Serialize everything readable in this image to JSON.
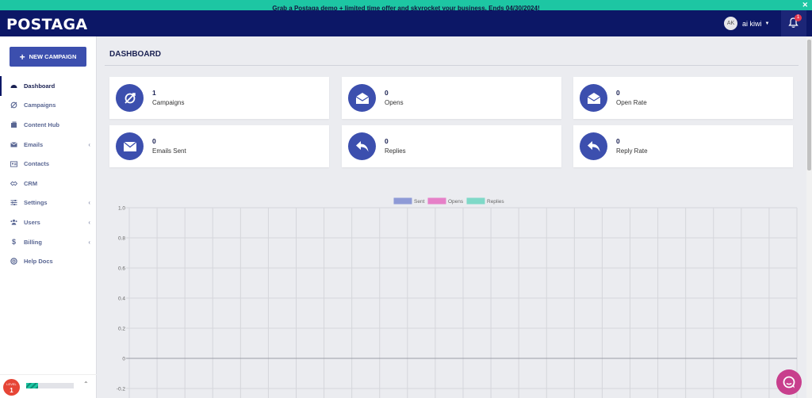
{
  "promo": {
    "text": "Grab a Postaga demo + limited time offer and skyrocket your business. Ends 04/30/2024!",
    "close": "✕"
  },
  "header": {
    "logo": "POSTAGA",
    "user": {
      "initials": "AK",
      "name": "ai kiwi"
    },
    "notifications": {
      "count": "1"
    }
  },
  "sidebar": {
    "new_campaign": "NEW CAMPAIGN",
    "items": [
      {
        "label": "Dashboard",
        "icon": "dashboard-icon",
        "active": true,
        "has_submenu": false
      },
      {
        "label": "Campaigns",
        "icon": "campaigns-icon",
        "active": false,
        "has_submenu": false
      },
      {
        "label": "Content Hub",
        "icon": "content-hub-icon",
        "active": false,
        "has_submenu": false
      },
      {
        "label": "Emails",
        "icon": "envelope-icon",
        "active": false,
        "has_submenu": true
      },
      {
        "label": "Contacts",
        "icon": "contacts-icon",
        "active": false,
        "has_submenu": false
      },
      {
        "label": "CRM",
        "icon": "crm-icon",
        "active": false,
        "has_submenu": false
      },
      {
        "label": "Settings",
        "icon": "settings-icon",
        "active": false,
        "has_submenu": true
      },
      {
        "label": "Users",
        "icon": "users-icon",
        "active": false,
        "has_submenu": true
      },
      {
        "label": "Billing",
        "icon": "dollar-icon",
        "active": false,
        "has_submenu": true
      },
      {
        "label": "Help Docs",
        "icon": "help-icon",
        "active": false,
        "has_submenu": false
      }
    ],
    "level": {
      "label": "LEVEL",
      "value": "1",
      "progress": 0.25
    }
  },
  "main": {
    "title": "DASHBOARD",
    "stats": [
      {
        "value": "1",
        "label": "Campaigns",
        "icon": "campaigns-icon"
      },
      {
        "value": "0",
        "label": "Opens",
        "icon": "open-envelope-icon"
      },
      {
        "value": "0",
        "label": "Open Rate",
        "icon": "open-envelope-icon"
      },
      {
        "value": "0",
        "label": "Emails Sent",
        "icon": "envelope-icon"
      },
      {
        "value": "0",
        "label": "Replies",
        "icon": "reply-icon"
      },
      {
        "value": "0",
        "label": "Reply Rate",
        "icon": "reply-icon"
      }
    ]
  },
  "colors": {
    "brand": "#0c1766",
    "accent": "#3c4fae",
    "promo": "#1dc6a3",
    "chat": "#c83f8d"
  },
  "chart_data": {
    "type": "line",
    "x": [],
    "series": [
      {
        "name": "Sent",
        "values": [],
        "color": "#8e9ad6"
      },
      {
        "name": "Opens",
        "values": [],
        "color": "#e680c8"
      },
      {
        "name": "Replies",
        "values": [],
        "color": "#7fd9c8"
      }
    ],
    "yticks": [
      "1.0",
      "0.8",
      "0.6",
      "0.4",
      "0.2",
      "0",
      "-0.2"
    ],
    "ylim": [
      -0.2,
      1.0
    ],
    "grid": true,
    "legend": "top-center"
  }
}
